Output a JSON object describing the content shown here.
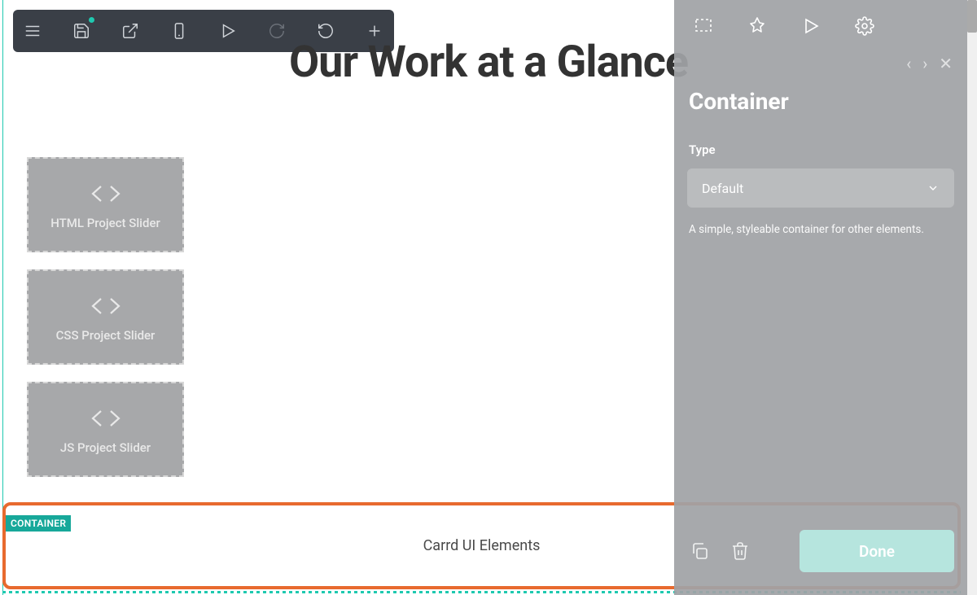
{
  "heading": "Our Work at a Glance",
  "toolbar": {
    "items": [
      "menu",
      "save",
      "open-external",
      "mobile",
      "play",
      "redo",
      "undo",
      "add"
    ]
  },
  "elements": [
    {
      "label": "HTML Project Slider"
    },
    {
      "label": "CSS Project Slider"
    },
    {
      "label": "JS Project Slider"
    }
  ],
  "highlight": {
    "tag": "CONTAINER",
    "text": "Carrd UI Elements"
  },
  "panel": {
    "title": "Container",
    "field_label": "Type",
    "select_value": "Default",
    "help_text": "A simple, styleable container for other elements.",
    "done_label": "Done"
  }
}
